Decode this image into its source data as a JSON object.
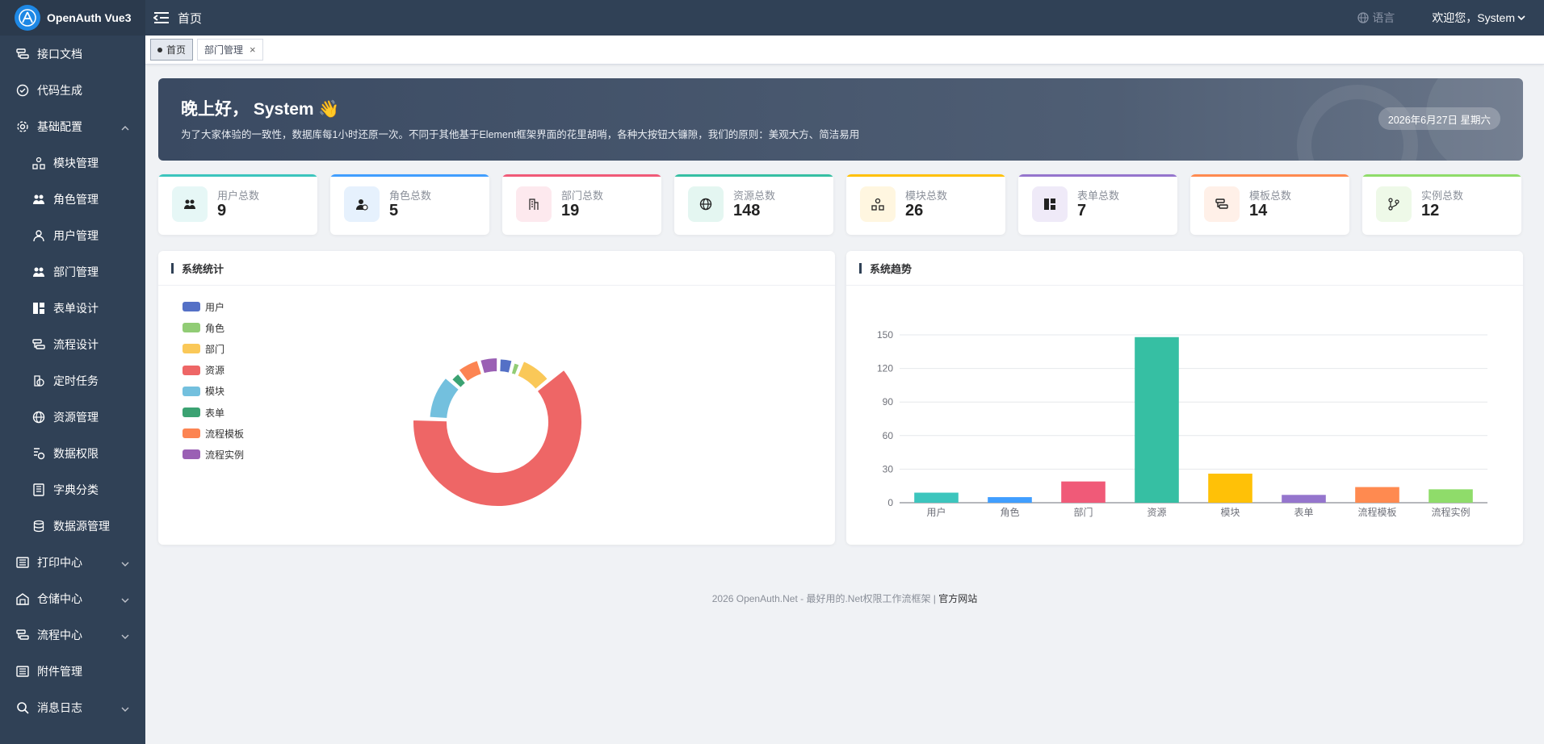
{
  "header": {
    "brand": "OpenAuth Vue3",
    "home": "首页",
    "language": "语言",
    "welcome": "欢迎您，System"
  },
  "sidebar": {
    "items": [
      {
        "label": "接口文档",
        "icon": "api-doc-icon",
        "sub": false,
        "chevron": ""
      },
      {
        "label": "代码生成",
        "icon": "check-circle-icon",
        "sub": false,
        "chevron": ""
      },
      {
        "label": "基础配置",
        "icon": "gear-icon",
        "sub": false,
        "chevron": "up"
      },
      {
        "label": "模块管理",
        "icon": "module-icon",
        "sub": true,
        "chevron": ""
      },
      {
        "label": "角色管理",
        "icon": "users-icon",
        "sub": true,
        "chevron": ""
      },
      {
        "label": "用户管理",
        "icon": "user-icon",
        "sub": true,
        "chevron": ""
      },
      {
        "label": "部门管理",
        "icon": "department-icon",
        "sub": true,
        "chevron": ""
      },
      {
        "label": "表单设计",
        "icon": "form-icon",
        "sub": true,
        "chevron": ""
      },
      {
        "label": "流程设计",
        "icon": "flow-icon",
        "sub": true,
        "chevron": ""
      },
      {
        "label": "定时任务",
        "icon": "timer-icon",
        "sub": true,
        "chevron": ""
      },
      {
        "label": "资源管理",
        "icon": "globe-icon",
        "sub": true,
        "chevron": ""
      },
      {
        "label": "数据权限",
        "icon": "permission-icon",
        "sub": true,
        "chevron": ""
      },
      {
        "label": "字典分类",
        "icon": "dictionary-icon",
        "sub": true,
        "chevron": ""
      },
      {
        "label": "数据源管理",
        "icon": "database-icon",
        "sub": true,
        "chevron": ""
      },
      {
        "label": "打印中心",
        "icon": "print-icon",
        "sub": false,
        "chevron": "down"
      },
      {
        "label": "仓储中心",
        "icon": "warehouse-icon",
        "sub": false,
        "chevron": "down"
      },
      {
        "label": "流程中心",
        "icon": "flow-center-icon",
        "sub": false,
        "chevron": "down"
      },
      {
        "label": "附件管理",
        "icon": "attachment-icon",
        "sub": false,
        "chevron": ""
      },
      {
        "label": "消息日志",
        "icon": "search-icon",
        "sub": false,
        "chevron": "down"
      }
    ]
  },
  "tabs": [
    {
      "label": "首页",
      "active": true
    },
    {
      "label": "部门管理",
      "active": false,
      "close": "×"
    }
  ],
  "banner": {
    "title": "晚上好， System 👋",
    "subtitle": "为了大家体验的一致性，数据库每1小时还原一次。不同于其他基于Element框架界面的花里胡哨，各种大按钮大镰隙，我们的原则：美观大方、简洁易用",
    "date": "2026年6月27日 星期六"
  },
  "stats": [
    {
      "label": "用户总数",
      "value": "9",
      "color": "#3cc5bd",
      "bg": "#e6f7f6",
      "icon": "users-icon"
    },
    {
      "label": "角色总数",
      "value": "5",
      "color": "#409eff",
      "bg": "#e6f1fd",
      "icon": "role-icon"
    },
    {
      "label": "部门总数",
      "value": "19",
      "color": "#f05a78",
      "bg": "#fde9ee",
      "icon": "building-icon"
    },
    {
      "label": "资源总数",
      "value": "148",
      "color": "#36bfa3",
      "bg": "#e4f6f1",
      "icon": "globe-icon"
    },
    {
      "label": "模块总数",
      "value": "26",
      "color": "#ffc107",
      "bg": "#fff6e0",
      "icon": "module-icon"
    },
    {
      "label": "表单总数",
      "value": "7",
      "color": "#9575cd",
      "bg": "#efeaf8",
      "icon": "form-icon"
    },
    {
      "label": "模板总数",
      "value": "14",
      "color": "#ff8a50",
      "bg": "#fff0e8",
      "icon": "template-icon"
    },
    {
      "label": "实例总数",
      "value": "12",
      "color": "#8fdc6a",
      "bg": "#eef9e8",
      "icon": "flow-instance-icon"
    }
  ],
  "panels": {
    "stats_title": "系统统计",
    "trend_title": "系统趋势"
  },
  "chart_data": [
    {
      "type": "pie",
      "categories": [
        "用户",
        "角色",
        "部门",
        "资源",
        "模块",
        "表单",
        "流程模板",
        "流程实例"
      ],
      "values": [
        9,
        5,
        19,
        148,
        26,
        7,
        14,
        12
      ],
      "colors": [
        "#5470c6",
        "#91cc75",
        "#fac858",
        "#ee6666",
        "#73c0de",
        "#3ba272",
        "#fc8452",
        "#9a60b4"
      ],
      "legend": "left"
    },
    {
      "type": "bar",
      "categories": [
        "用户",
        "角色",
        "部门",
        "资源",
        "模块",
        "表单",
        "流程模板",
        "流程实例"
      ],
      "values": [
        9,
        5,
        19,
        148,
        26,
        7,
        14,
        12
      ],
      "colors": [
        "#3cc5bd",
        "#409eff",
        "#f05a78",
        "#36bfa3",
        "#ffc107",
        "#9575cd",
        "#ff8a50",
        "#8fdc6a"
      ],
      "yticks": [
        0,
        30,
        60,
        90,
        120,
        150
      ],
      "ylim": [
        0,
        150
      ]
    }
  ],
  "footer": {
    "text": "2026 OpenAuth.Net - 最好用的.Net权限工作流框架 | ",
    "link": "官方网站"
  }
}
